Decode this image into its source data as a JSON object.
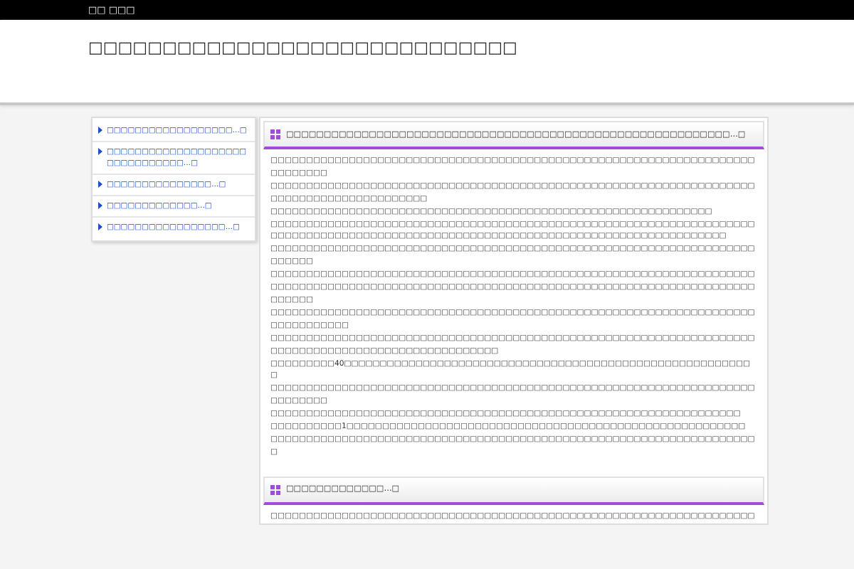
{
  "top_bar": {
    "text": "□□ □□□"
  },
  "header": {
    "title": "□□□□□□□□□□□□□□□□□□□□□□□□□□□□□"
  },
  "sidebar": {
    "items": [
      {
        "label": "□□□□□□□□□□□□□□□□□□…□"
      },
      {
        "label": "□□□□□□□□□□□□□□□□□□□□□□□□□□□□□□□…□"
      },
      {
        "label": "□□□□□□□□□□□□□□□…□"
      },
      {
        "label": "□□□□□□□□□□□□□…□"
      },
      {
        "label": "□□□□□□□□□□□□□□□□□…□"
      }
    ]
  },
  "sections": [
    {
      "title": "□□□□□□□□□□□□□□□□□□□□□□□□□□□□□□□□□□□□□□□□□□□□□□□□□□□□□□□□□□□…□",
      "paragraphs": [
        "□□□□□□□□□□□□□□□□□□□□□□□□□□□□□□□□□□□□□□□□□□□□□□□□□□□□□□□□□□□□□□□□□□□□□□□□□□□□",
        "□□□□□□□□□□□□□□□□□□□□□□□□□□□□□□□□□□□□□□□□□□□□□□□□□□□□□□□□□□□□□□□□□□□□□□□□□□□□□□□□□□□□□□□□□□",
        "□□□□□□□□□□□□□□□□□□□□□□□□□□□□□□□□□□□□□□□□□□□□□□□□□□□□□□□□□□□□□□",
        "□□□□□□□□□□□□□□□□□□□□□□□□□□□□□□□□□□□□□□□□□□□□□□□□□□□□□□□□□□□□□□□□□□□□",
        "□□□□□□□□□□□□□□□□□□□□□□□□□□□□□□□□□□□□□□□□□□□□□□□□□□□□□□□□□□□□□□□□",
        "□□□□□□□□□□□□□□□□□□□□□□□□□□□□□□□□□□□□□□□□□□□□□□□□□□□□□□□□□□□□□□□□□□□□□□□□□□",
        "□□□□□□□□□□□□□□□□□□□□□□□□□□□□□□□□□□□□□□□□□□□□□□□□□□□□□□□□□□□□□□□□□□□□□□□□□□□□□□□□□□□□□□□□□□□□□□□□□□□□□□□□□□□□□□□□□□□□□□□□□□□□□□□□□□□□□□□□□□□□□□",
        "□□□□□□□□□□□□□□□□□□□□□□□□□□□□□□□□□□□□□□□□□□□□□□□□□□□□□□□□□□□□□□□□□□□□□□□□□□□□□□□",
        "□□□□□□□□□□□□□□□□□□□□□□□□□□□□□□□□□□□□□□□□□□□□□□□□□□□□□□□□□□□□□□□□□□□□□□□□□□□□□□□□□□□□□□□□□□□□□□□□□□□□",
        "□□□□□□□□□40□□□□□□□□□□□□□□□□□□□□□□□□□□□□□□□□□□□□□□□□□□□□□□□□□□□□□□□□□□",
        "□□□□□□□□□□□□□□□□□□□□□□□□□□□□□□□□□□□□□□□□□□□□□□□□□□□□□□□□□□□□□□□□□□□□□□□□□□□□",
        "□□□□□□□□□□□□□□□□□□□□□□□□□□□□□□□□□□□□□□□□□□□□□□□□□□□□□□□□□□□□□□□□□□",
        "□□□□□□□□□□1□□□□□□□□□□□□□□□□□□□□□□□□□□□□□□□□□□□□□□□□□□□□□□□□□□□□□□□□",
        "□□□□□□□□□□□□□□□□□□□□□□□□□□□□□□□□□□□□□□□□□□□□□□□□□□□□□□□□□□□□□□□□□□□□□"
      ]
    },
    {
      "title": "□□□□□□□□□□□□□…□",
      "paragraphs": [
        "□□□□□□□□□□□□□□□□□□□□□□□□□□□□□□□□□□□□□□□□□□□□□□□□□□□□□□□□□□□□□□□□□□□□"
      ]
    }
  ]
}
